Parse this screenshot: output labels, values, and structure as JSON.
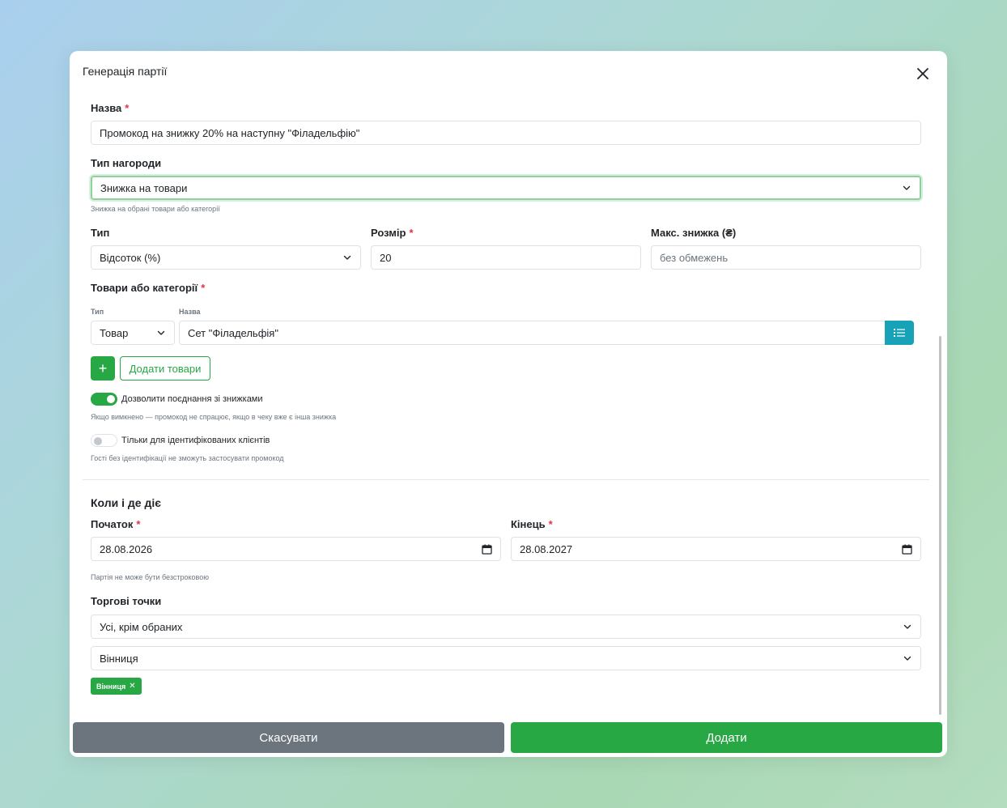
{
  "modal": {
    "title": "Генерація партії",
    "close_icon": "close-icon"
  },
  "form": {
    "name": {
      "label": "Назва",
      "required": "*",
      "value": "Промокод на знижку 20% на наступну \"Філадельфію\""
    },
    "reward_type": {
      "label": "Тип нагороди",
      "value": "Знижка на товари",
      "help": "Знижка на обрані товари або категорії"
    },
    "discount_type": {
      "label": "Тип",
      "value": "Відсоток (%)"
    },
    "size": {
      "label": "Розмір",
      "required": "*",
      "value": "20"
    },
    "max_discount": {
      "label": "Макс. знижка (₴)",
      "placeholder": "без обмежень"
    },
    "products": {
      "label": "Товари або категорії",
      "required": "*",
      "col_type": "Тип",
      "col_name": "Назва",
      "row": {
        "type": "Товар",
        "name": "Сет \"Філадельфія\""
      },
      "add_plus": "+",
      "add_label": "Додати товари"
    },
    "allow_combine": {
      "label": "Дозволити поєднання зі знижками",
      "help": "Якщо вимкнено — промокод не спрацює, якщо в чеку вже є інша знижка",
      "on": true
    },
    "identified_only": {
      "label": "Тільки для ідентифікованих клієнтів",
      "help": "Гості без ідентифікації не зможуть застосувати промокод",
      "on": false
    }
  },
  "when_where": {
    "title": "Коли і де діє",
    "start": {
      "label": "Початок",
      "required": "*",
      "value": "28.08.2026"
    },
    "end": {
      "label": "Кінець",
      "required": "*",
      "value": "28.08.2027"
    },
    "period_help": "Партія не може бути безстроковою",
    "outlets": {
      "label": "Торгові точки",
      "mode": "Усі, крім обраних",
      "city": "Вінниця",
      "badges": [
        {
          "label": "Вінниця"
        }
      ]
    }
  },
  "footer": {
    "cancel": "Скасувати",
    "add": "Додати"
  },
  "colors": {
    "primary": "#28a745",
    "secondary": "#6c757d",
    "info": "#17a2b8",
    "danger": "#dc3545"
  }
}
